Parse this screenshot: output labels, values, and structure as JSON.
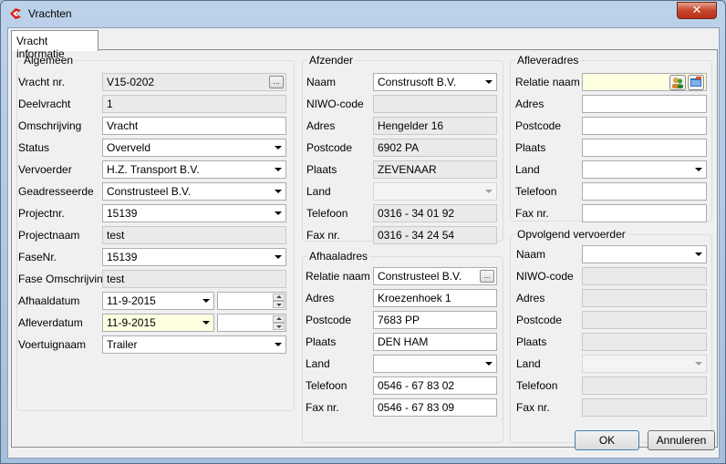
{
  "window": {
    "title": "Vrachten",
    "close_glyph": "✕"
  },
  "tab": {
    "label": "Vracht informatie"
  },
  "algemeen": {
    "title": "Algemeen",
    "vracht_nr": {
      "label": "Vracht nr.",
      "value": "V15-0202"
    },
    "deelvracht": {
      "label": "Deelvracht",
      "value": "1"
    },
    "omschrijving": {
      "label": "Omschrijving",
      "value": "Vracht"
    },
    "status": {
      "label": "Status",
      "value": "Overveld"
    },
    "vervoerder": {
      "label": "Vervoerder",
      "value": "H.Z. Transport B.V."
    },
    "geadresseerde": {
      "label": "Geadresseerde",
      "value": "Construsteel  B.V."
    },
    "projectnr": {
      "label": "Projectnr.",
      "value": "15139"
    },
    "projectnaam": {
      "label": "Projectnaam",
      "value": "test"
    },
    "fasenr": {
      "label": "FaseNr.",
      "value": "15139"
    },
    "fase_omschrijving": {
      "label": "Fase Omschrijving",
      "value": "test"
    },
    "afhaaldatum": {
      "label": "Afhaaldatum",
      "value": "11-9-2015",
      "time": ""
    },
    "afleverdatum": {
      "label": "Afleverdatum",
      "value": "11-9-2015",
      "time": ""
    },
    "voertuignaam": {
      "label": "Voertuignaam",
      "value": "Trailer"
    }
  },
  "afzender": {
    "title": "Afzender",
    "naam": {
      "label": "Naam",
      "value": "Construsoft B.V."
    },
    "niwo": {
      "label": "NIWO-code",
      "value": ""
    },
    "adres": {
      "label": "Adres",
      "value": "Hengelder  16"
    },
    "postcode": {
      "label": "Postcode",
      "value": "6902 PA"
    },
    "plaats": {
      "label": "Plaats",
      "value": "ZEVENAAR"
    },
    "land": {
      "label": "Land",
      "value": ""
    },
    "telefoon": {
      "label": "Telefoon",
      "value": "0316 - 34 01 92"
    },
    "fax": {
      "label": "Fax nr.",
      "value": "0316 - 34 24 54"
    }
  },
  "afhaaladres": {
    "title": "Afhaaladres",
    "relatie": {
      "label": "Relatie naam",
      "value": "Construsteel  B.V."
    },
    "adres": {
      "label": "Adres",
      "value": "Kroezenhoek 1"
    },
    "postcode": {
      "label": "Postcode",
      "value": "7683 PP"
    },
    "plaats": {
      "label": "Plaats",
      "value": "DEN HAM"
    },
    "land": {
      "label": "Land",
      "value": ""
    },
    "telefoon": {
      "label": "Telefoon",
      "value": "0546 - 67 83 02"
    },
    "fax": {
      "label": "Fax nr.",
      "value": "0546 - 67 83 09"
    }
  },
  "afleveradres": {
    "title": "Afleveradres",
    "relatie": {
      "label": "Relatie naam",
      "value": ""
    },
    "adres": {
      "label": "Adres",
      "value": ""
    },
    "postcode": {
      "label": "Postcode",
      "value": ""
    },
    "plaats": {
      "label": "Plaats",
      "value": ""
    },
    "land": {
      "label": "Land",
      "value": ""
    },
    "telefoon": {
      "label": "Telefoon",
      "value": ""
    },
    "fax": {
      "label": "Fax nr.",
      "value": ""
    }
  },
  "opvolgend": {
    "title": "Opvolgend vervoerder",
    "naam": {
      "label": "Naam",
      "value": ""
    },
    "niwo": {
      "label": "NIWO-code",
      "value": ""
    },
    "adres": {
      "label": "Adres",
      "value": ""
    },
    "postcode": {
      "label": "Postcode",
      "value": ""
    },
    "plaats": {
      "label": "Plaats",
      "value": ""
    },
    "land": {
      "label": "Land",
      "value": ""
    },
    "telefoon": {
      "label": "Telefoon",
      "value": ""
    },
    "fax": {
      "label": "Fax nr.",
      "value": ""
    }
  },
  "buttons": {
    "ok": "OK",
    "cancel": "Annuleren",
    "ellipsis": "..."
  },
  "colors": {
    "highlight_field": "#ffffe1",
    "readonly_field": "#eaeaea",
    "app_icon": "#d6231e"
  }
}
